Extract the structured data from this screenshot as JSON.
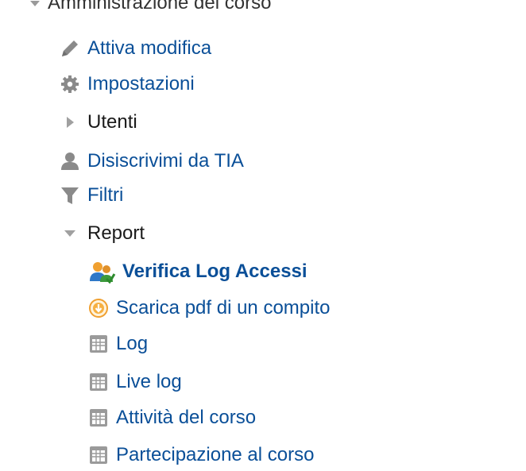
{
  "section": {
    "title": "Amministrazione del corso",
    "items": [
      {
        "label": "Attiva modifica",
        "icon": "pencil-icon"
      },
      {
        "label": "Impostazioni",
        "icon": "gear-icon"
      },
      {
        "label": "Utenti",
        "icon": "caret-right-icon"
      },
      {
        "label": "Disiscrivimi da TIA",
        "icon": "user-icon"
      },
      {
        "label": "Filtri",
        "icon": "filter-icon"
      },
      {
        "label": "Report",
        "icon": "caret-down-icon"
      }
    ],
    "report_items": [
      {
        "label": "Verifica Log Accessi",
        "icon": "users-log-icon"
      },
      {
        "label": "Scarica pdf di un compito",
        "icon": "download-circle-icon"
      },
      {
        "label": "Log",
        "icon": "report-icon"
      },
      {
        "label": "Live log",
        "icon": "report-icon"
      },
      {
        "label": "Attività del corso",
        "icon": "report-icon"
      },
      {
        "label": "Partecipazione al corso",
        "icon": "report-icon"
      }
    ]
  },
  "colors": {
    "link": "#0a4f98",
    "text": "#1a1a1a",
    "icon_gray": "#8a8a8a"
  }
}
